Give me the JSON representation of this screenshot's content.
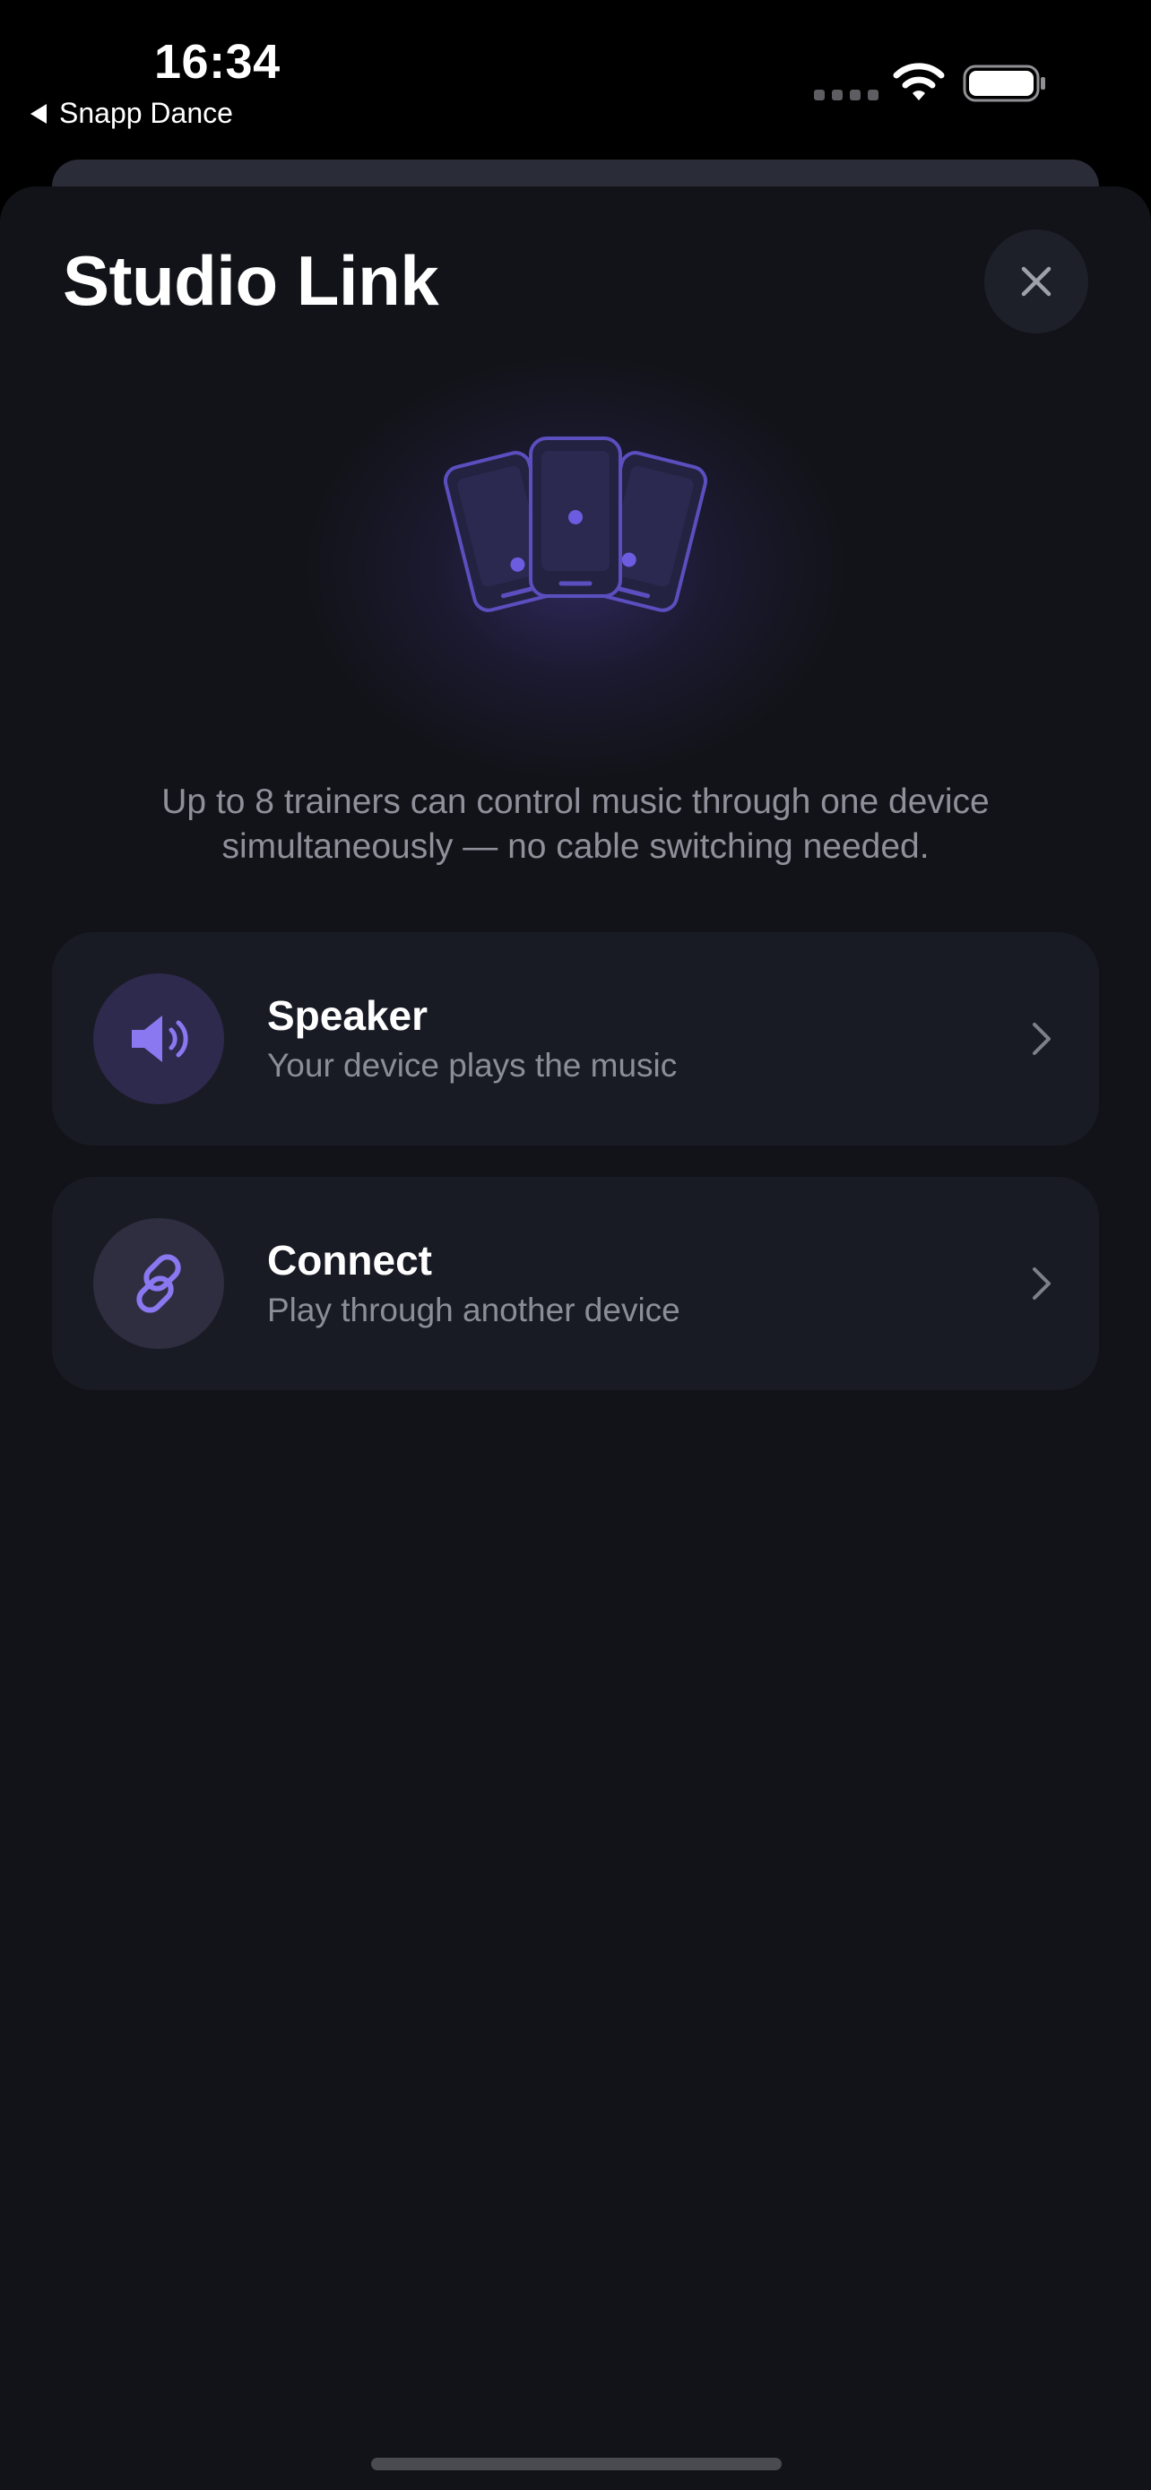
{
  "status_bar": {
    "time": "16:34",
    "back_app": "Snapp Dance",
    "icons": [
      "back-caret-icon",
      "cellular-signal-icon",
      "wifi-icon",
      "battery-icon"
    ]
  },
  "sheet": {
    "title": "Studio Link",
    "close_icon": "close-icon",
    "illustration": "devices-icon",
    "description": "Up to 8 trainers can control music through one device simultaneously — no cable switching needed."
  },
  "options": [
    {
      "title": "Speaker",
      "subtitle": "Your device plays the music",
      "icon": "speaker-icon"
    },
    {
      "title": "Connect",
      "subtitle": "Play through another device",
      "icon": "link-icon"
    }
  ],
  "colors": {
    "background": "#121318",
    "card": "#191b24",
    "accent": "#8a78f0",
    "muted_text": "#8e909a"
  }
}
